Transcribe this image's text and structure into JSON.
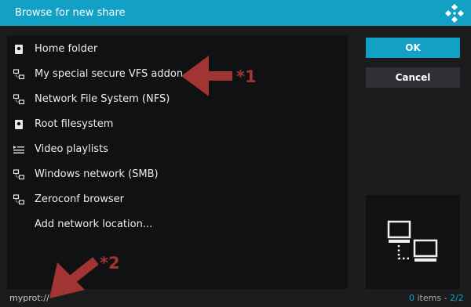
{
  "window": {
    "title": "Browse for new share"
  },
  "sources": [
    {
      "label": "Home folder",
      "icon": "hard-drive-icon"
    },
    {
      "label": "My special secure VFS addon",
      "icon": "network-icon"
    },
    {
      "label": "Network File System (NFS)",
      "icon": "network-icon"
    },
    {
      "label": "Root filesystem",
      "icon": "hard-drive-icon"
    },
    {
      "label": "Video playlists",
      "icon": "playlist-icon"
    },
    {
      "label": "Windows network (SMB)",
      "icon": "network-icon"
    },
    {
      "label": "Zeroconf browser",
      "icon": "network-icon"
    },
    {
      "label": "Add network location...",
      "icon": ""
    }
  ],
  "buttons": {
    "ok": "OK",
    "cancel": "Cancel"
  },
  "footer": {
    "path": "myprot://",
    "items_count": "0",
    "items_label": " items - ",
    "page": "2/2"
  },
  "annotations": {
    "marker1": "*1",
    "marker2": "*2"
  },
  "colors": {
    "accent": "#12a0c4",
    "annotation": "#a23433"
  }
}
